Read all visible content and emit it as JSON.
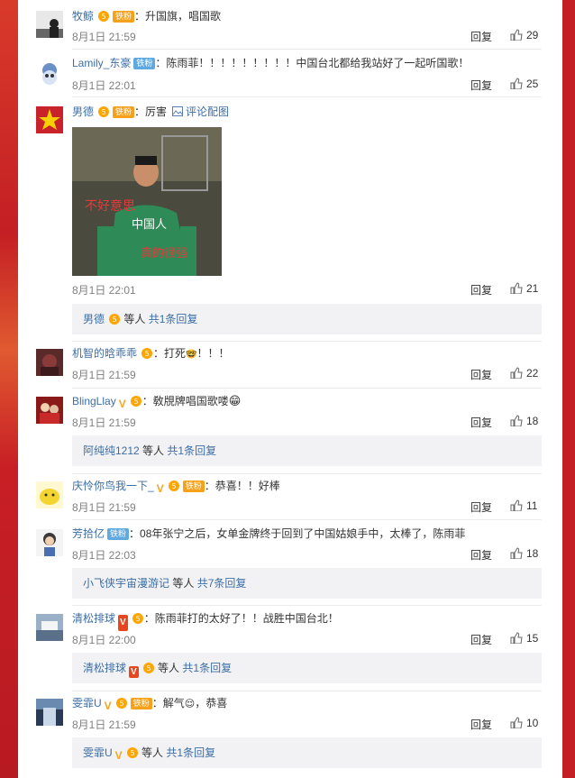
{
  "reply_label": "回复",
  "comments": [
    {
      "user": "牧鲸",
      "text": "：升国旗，唱国歌",
      "date": "8月1日 21:59",
      "likes": "29",
      "badges": [
        "vip",
        "tiefen"
      ]
    },
    {
      "user": "Lamily_东豪",
      "text": "：陈雨菲！！！！！！！！！中国台北都给我站好了一起听国歌！",
      "date": "8月1日 22:01",
      "likes": "25",
      "badges": [
        "tiefen-blue"
      ]
    },
    {
      "user": "男德",
      "text": "：厉害",
      "pic_link": "评论配图",
      "date": "8月1日 22:01",
      "likes": "21",
      "badges": [
        "vip",
        "tiefen"
      ],
      "picture": {
        "caption_1": "不好意思",
        "caption_2": "中国人",
        "caption_3": "真的很强"
      },
      "sub": {
        "user": "男德",
        "text": "等人",
        "count": "共1条回复"
      }
    },
    {
      "user": "机智的晗乖乖",
      "text": "：打死",
      "text_tail": "！！！",
      "date": "8月1日 21:59",
      "likes": "22",
      "badges": [
        "vip"
      ]
    },
    {
      "user": "BlingLlay",
      "text": "：敎覑牌唱国歌喽",
      "date": "8月1日 21:59",
      "likes": "18",
      "badges": [
        "v",
        "vip"
      ],
      "sub": {
        "user": "阿纯纯1212",
        "text": "等人",
        "count": "共1条回复"
      }
    },
    {
      "user": "庆怜你鸟我一下_",
      "text": "：恭喜！！好棒",
      "date": "8月1日 21:59",
      "likes": "11",
      "badges": [
        "v",
        "vip",
        "tiefen"
      ]
    },
    {
      "user": "芳拾亿",
      "text": "：08年张宁之后，女单金牌终于回到了中国姑娘手中，太棒了，陈雨菲",
      "date": "8月1日 22:03",
      "likes": "18",
      "badges": [
        "tiefen-blue"
      ],
      "sub": {
        "user": "小飞侠宇宙漫游记",
        "text": "等人",
        "count": "共7条回复"
      }
    },
    {
      "user": "清松排球",
      "text": "：陈雨菲打的太好了！！战胜中国台北！",
      "date": "8月1日 22:00",
      "likes": "15",
      "badges": [
        "v-red",
        "vip"
      ],
      "sub": {
        "user": "清松排球",
        "text": "等人",
        "count": "共1条回复",
        "badges": [
          "v-red",
          "vip"
        ]
      }
    },
    {
      "user": "雯霏U",
      "text": "：解气",
      "text_tail": "，恭喜",
      "date": "8月1日 21:59",
      "likes": "10",
      "badges": [
        "v",
        "vip",
        "tiefen"
      ],
      "sub": {
        "user": "雯霏U",
        "text": "等人",
        "count": "共1条回复",
        "badges": [
          "v",
          "vip"
        ]
      }
    }
  ],
  "fan_badge_label": "铁粉",
  "colors": {
    "link": "#3c6ea5",
    "meta": "#808080",
    "sub_bg": "#f2f2f5",
    "page_bg": "#c8222a"
  }
}
